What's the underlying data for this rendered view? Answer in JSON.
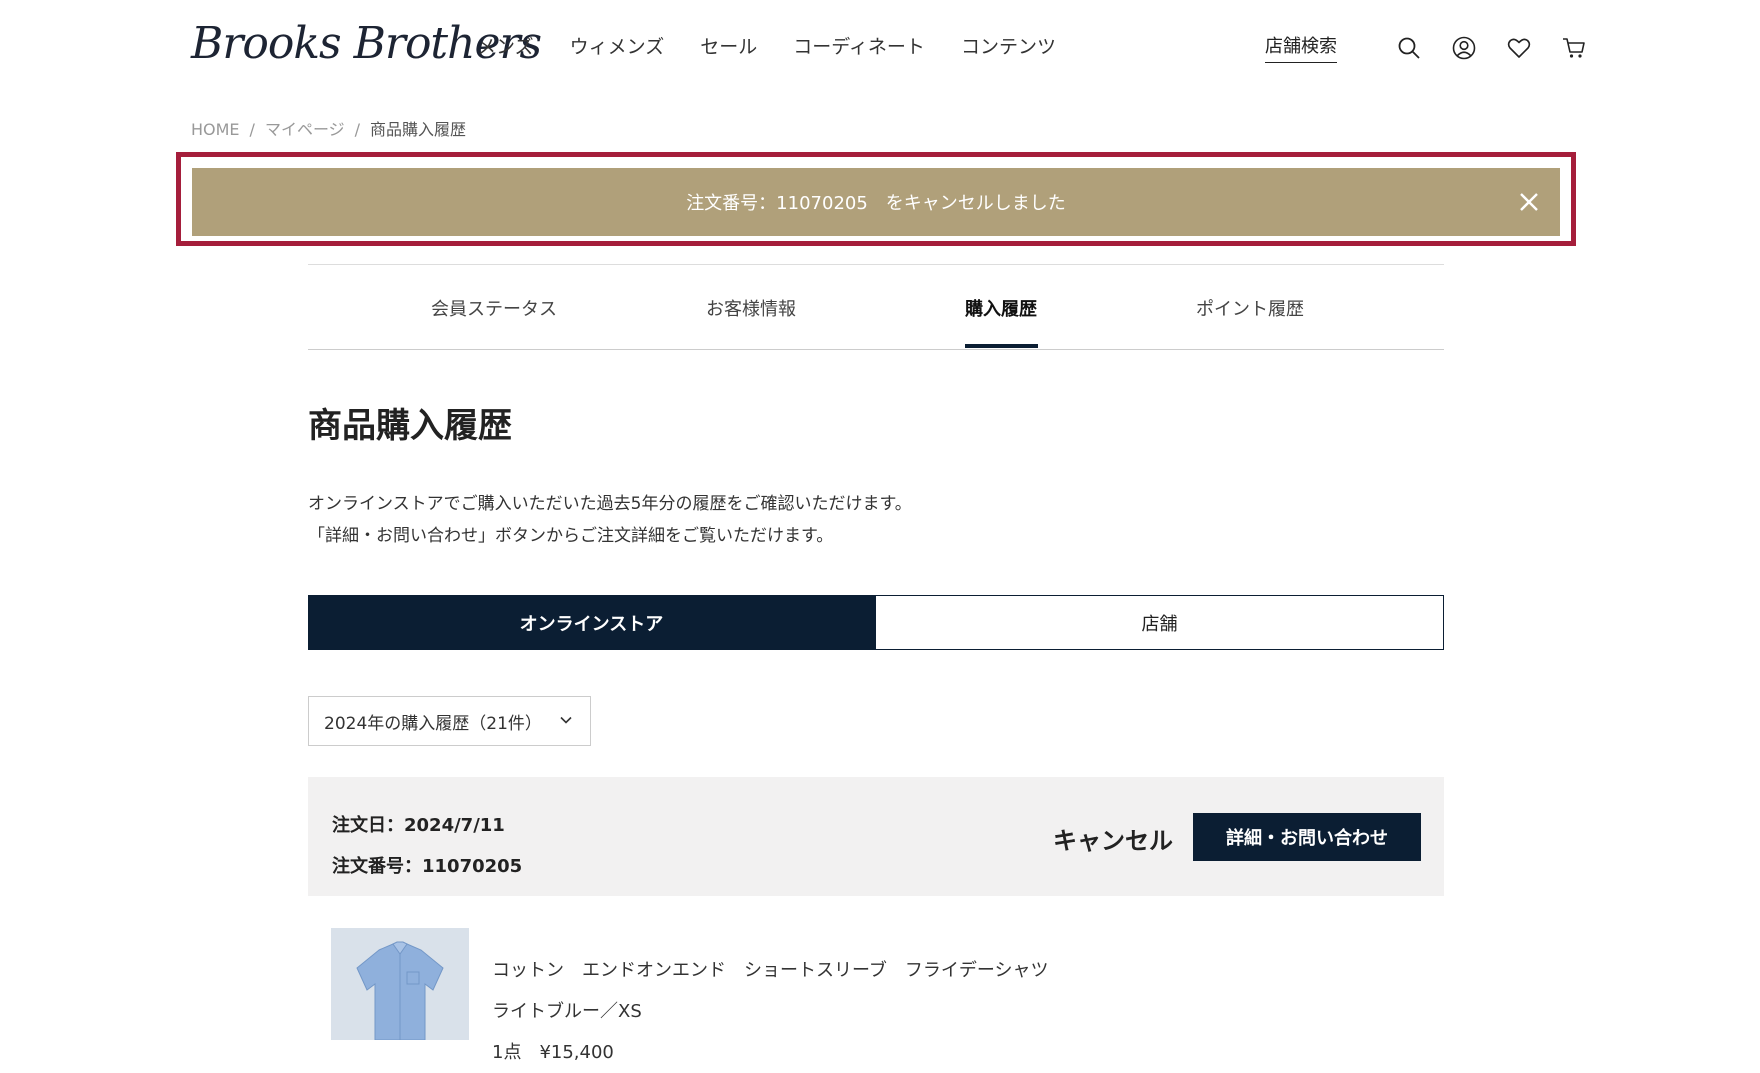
{
  "header": {
    "logo_text": "Brooks Brothers",
    "nav": [
      "メンズ",
      "ウィメンズ",
      "セール",
      "コーディネート",
      "コンテンツ"
    ],
    "store_search": "店舗検索",
    "icons": [
      "search-icon",
      "account-icon",
      "heart-icon",
      "cart-icon"
    ]
  },
  "breadcrumb": {
    "items": [
      "HOME",
      "マイページ",
      "商品購入履歴"
    ],
    "separator": "/"
  },
  "notice": {
    "message": "注文番号：11070205　をキャンセルしました",
    "bg_color": "#b0a07a",
    "highlight_color": "#a51e3b"
  },
  "tabs": {
    "items": [
      "会員ステータス",
      "お客様情報",
      "購入履歴",
      "ポイント履歴"
    ],
    "active": "購入履歴"
  },
  "page": {
    "title": "商品購入履歴",
    "desc_line1": "オンラインストアでご購入いただいた過去5年分の履歴をご確認いただけます。",
    "desc_line2": "「詳細・お問い合わせ」ボタンからご注文詳細をご覧いただけます。"
  },
  "segment": {
    "online": "オンラインストア",
    "store": "店舗",
    "active": "オンラインストア"
  },
  "year_filter": {
    "selected": "2024年の購入履歴（21件）"
  },
  "order": {
    "date_line": "注文日：2024/7/11",
    "number_line": "注文番号：11070205",
    "status": "キャンセル",
    "detail_button": "詳細・お問い合わせ"
  },
  "item": {
    "name": "コットン　エンドオンエンド　ショートスリーブ　フライデーシャツ",
    "variant": "ライトブルー／XS",
    "qty_price": "1点　¥15,400"
  },
  "colors": {
    "navy": "#0b1e33",
    "card_bg": "#f2f1f1"
  }
}
